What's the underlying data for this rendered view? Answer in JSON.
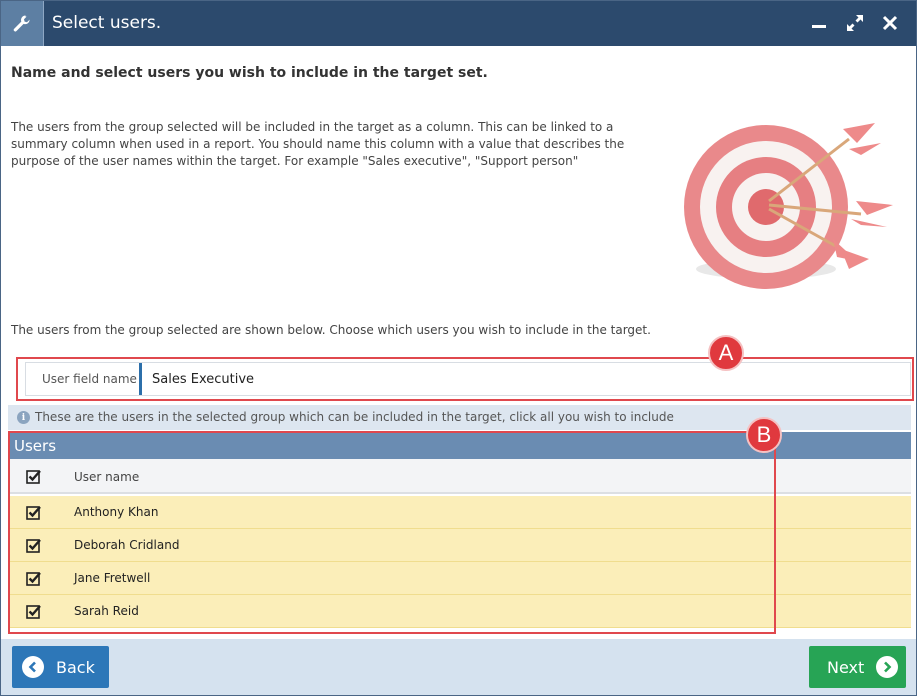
{
  "window": {
    "title": "Select users.",
    "icons": {
      "app": "wrench-icon",
      "minimize": "minimize-icon",
      "maximize": "maximize-icon",
      "close": "close-icon"
    }
  },
  "content": {
    "heading": "Name and select users you wish to include in the target set.",
    "description": "The users from the group selected will be included in the target as a column. This can be linked to a summary column when used in a report. You should name this column with a value that describes the purpose of the user names within the target. For example \"Sales executive\", \"Support person\"",
    "instruction": "The users from the group selected are shown below. Choose which users you wish to include in the target."
  },
  "field": {
    "label": "User field name",
    "value": "Sales Executive"
  },
  "badges": {
    "a": "A",
    "b": "B"
  },
  "info": {
    "icon": "info-icon",
    "text": "These are the users in the selected group which can be included in the target, click all you wish to include"
  },
  "users": {
    "title": "Users",
    "column_header": "User name",
    "rows": [
      {
        "name": "Anthony Khan",
        "checked": true
      },
      {
        "name": "Deborah Cridland",
        "checked": true
      },
      {
        "name": "Jane Fretwell",
        "checked": true
      },
      {
        "name": "Sarah Reid",
        "checked": true
      }
    ]
  },
  "footer": {
    "back_label": "Back",
    "next_label": "Next"
  },
  "colors": {
    "titlebar": "#2c4a6d",
    "accent": "#2d77b8",
    "next": "#27a455",
    "highlight_row": "#fbeeb9",
    "annotation": "#e0393e"
  }
}
